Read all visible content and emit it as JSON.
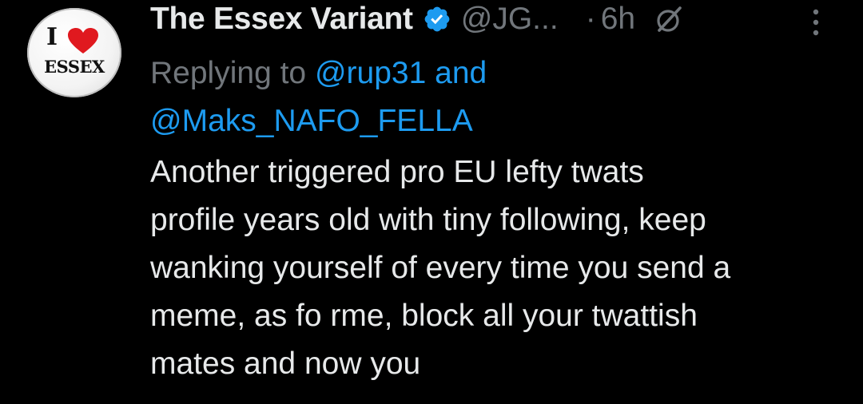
{
  "avatar": {
    "top_text": "I",
    "bottom_text": "ESSEX",
    "heart_color": "#e0191f"
  },
  "header": {
    "display_name": "The Essex Variant",
    "handle": "@JG...",
    "separator": "·",
    "time": "6h"
  },
  "reply": {
    "prefix": "Replying to",
    "mention_1": "@rup31",
    "conjunction": "and",
    "mention_2": "@Maks_NAFO_FELLA"
  },
  "body": {
    "lines": [
      "Another triggered pro EU lefty twats",
      "profile years old with tiny following, keep",
      "wanking yourself of every time you send a",
      "meme, as fo rme, block all your twattish",
      "mates and now you"
    ]
  },
  "icons": {
    "verified": "verified-badge-icon",
    "grok": "grok-icon",
    "more": "more-vertical-icon"
  },
  "colors": {
    "background": "#000000",
    "text_primary": "#e7e9ea",
    "text_secondary": "#71767b",
    "accent": "#1d9bf0"
  }
}
